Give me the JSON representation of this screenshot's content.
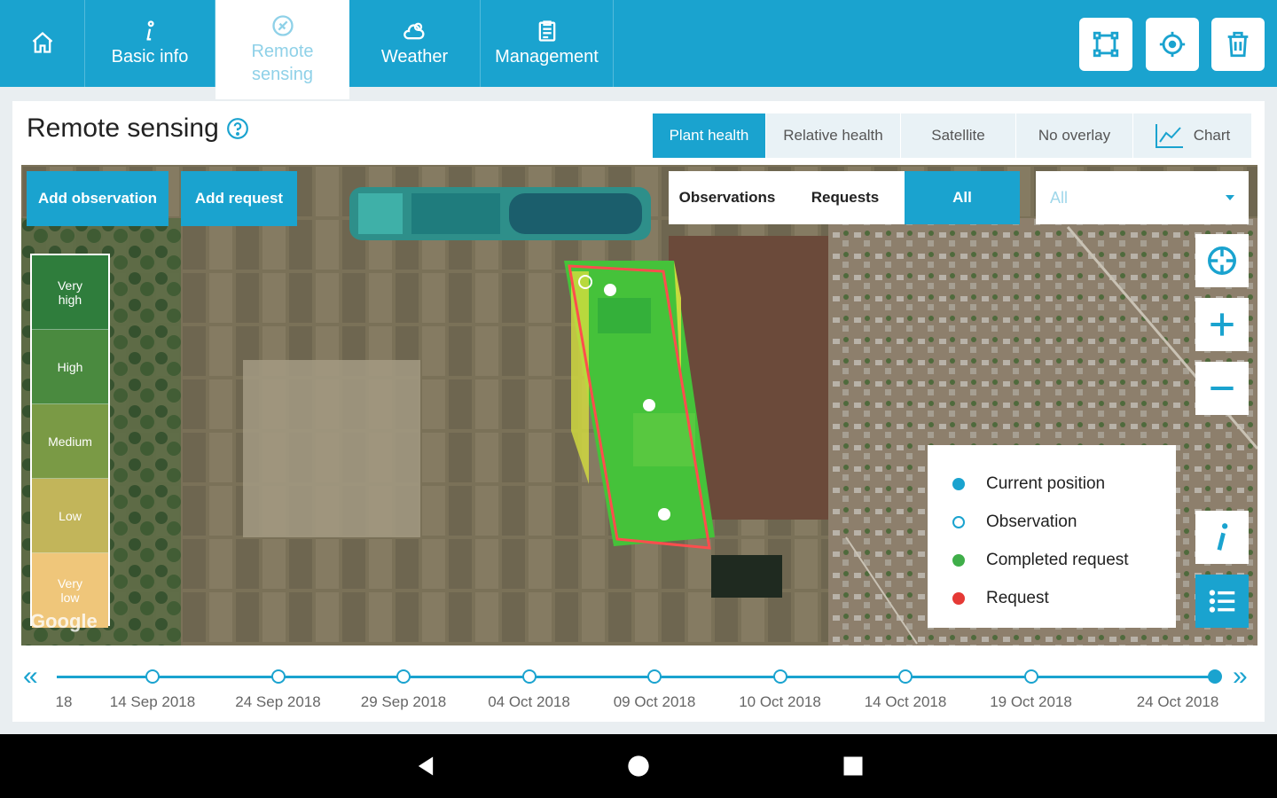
{
  "nav": {
    "tabs": [
      {
        "label": ""
      },
      {
        "label": "Basic info"
      },
      {
        "label": "Remote\nsensing"
      },
      {
        "label": "Weather"
      },
      {
        "label": "Management"
      }
    ]
  },
  "panel": {
    "title": "Remote sensing",
    "view_modes": [
      "Plant health",
      "Relative health",
      "Satellite",
      "No overlay",
      "Chart"
    ]
  },
  "map": {
    "add_observation": "Add observation",
    "add_request": "Add request",
    "filters": [
      "Observations",
      "Requests",
      "All"
    ],
    "dropdown_value": "All",
    "scale": [
      "Very\nhigh",
      "High",
      "Medium",
      "Low",
      "Very\nlow"
    ],
    "scale_colors": [
      "#2f7d3c",
      "#4a8a3f",
      "#7a9a45",
      "#c2b55a",
      "#efc67a"
    ],
    "legend": [
      {
        "label": "Current position",
        "color": "#1aa3cf"
      },
      {
        "label": "Observation",
        "color": "#ffffff"
      },
      {
        "label": "Completed request",
        "color": "#3fae49"
      },
      {
        "label": "Request",
        "color": "#e53935"
      }
    ],
    "attribution": "Google"
  },
  "timeline": {
    "dates": [
      "18",
      "14 Sep 2018",
      "24 Sep 2018",
      "29 Sep 2018",
      "04 Oct 2018",
      "09 Oct 2018",
      "10 Oct 2018",
      "14 Oct 2018",
      "19 Oct 2018",
      "24 Oct 2018"
    ],
    "selected_index": 9
  },
  "colors": {
    "accent": "#1aa3cf"
  }
}
